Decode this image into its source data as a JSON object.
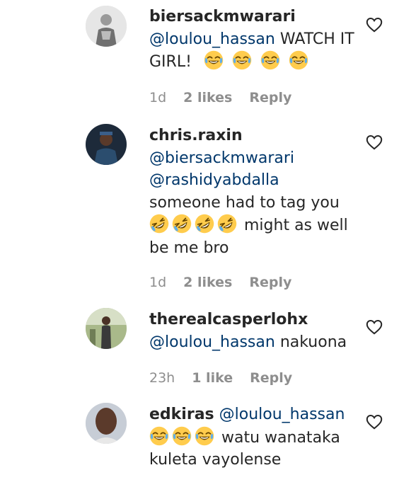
{
  "comments": [
    {
      "username": "biersackmwarari",
      "mention": "@loulou_hassan",
      "text": "WATCH IT GIRL!",
      "emoji": [
        "face-with-tears-of-joy",
        "face-with-tears-of-joy",
        "face-with-tears-of-joy",
        "face-with-tears-of-joy"
      ],
      "time": "1d",
      "likes": "2 likes",
      "reply": "Reply",
      "avatar": "user-photo-gray-tshirt",
      "heart_icon": "heart-outline-icon"
    },
    {
      "username": "chris.raxin",
      "mentions": [
        "@biersackmwarari",
        "@rashidyabdalla"
      ],
      "text_before": "someone had to tag you",
      "emoji": [
        "rolling-on-floor-laughing",
        "rolling-on-floor-laughing",
        "rolling-on-floor-laughing",
        "rolling-on-floor-laughing"
      ],
      "text_after": "might as well be me bro",
      "time": "1d",
      "likes": "2 likes",
      "reply": "Reply",
      "avatar": "user-photo-dark",
      "heart_icon": "heart-outline-icon"
    },
    {
      "username": "therealcasperlohx",
      "mention": "@loulou_hassan",
      "text": "nakuona",
      "time": "23h",
      "likes": "1 like",
      "reply": "Reply",
      "avatar": "user-photo-outdoor",
      "heart_icon": "heart-outline-icon"
    },
    {
      "username": "edkiras",
      "mention": "@loulou_hassan",
      "emoji": [
        "face-with-tears-of-joy",
        "face-with-tears-of-joy",
        "face-with-tears-of-joy"
      ],
      "text": "watu wanataka kuleta vayolense",
      "avatar": "user-photo-face",
      "heart_icon": "heart-outline-icon"
    }
  ],
  "colors": {
    "text": "#262626",
    "mention": "#00376b",
    "meta": "#8e8e8e",
    "emoji_yellow": "#ffcc4d"
  }
}
